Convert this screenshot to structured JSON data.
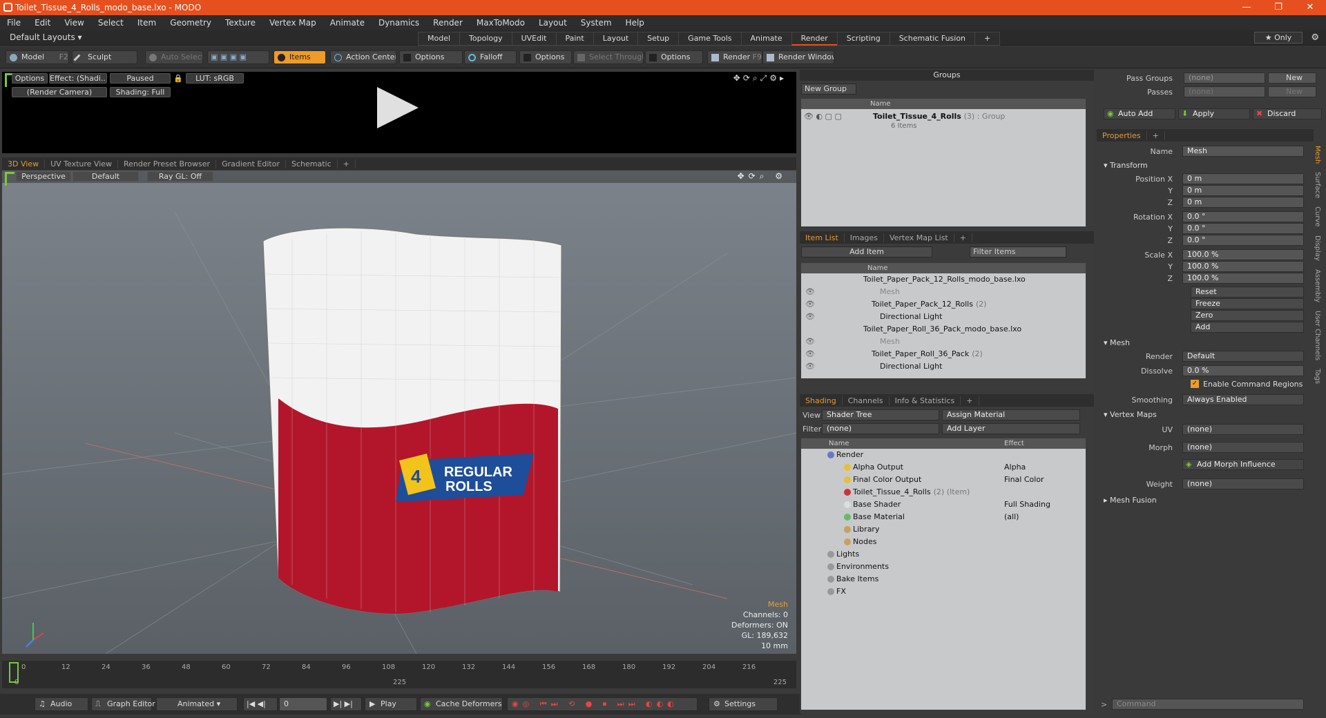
{
  "window": {
    "title": "Toilet_Tissue_4_Rolls_modo_base.lxo - MODO",
    "min": "—",
    "max": "❐",
    "close": "✕"
  },
  "menu": [
    "File",
    "Edit",
    "View",
    "Select",
    "Item",
    "Geometry",
    "Texture",
    "Vertex Map",
    "Animate",
    "Dynamics",
    "Render",
    "MaxToModo",
    "Layout",
    "System",
    "Help"
  ],
  "layouts": {
    "default": "Default Layouts ▾",
    "tabs": [
      "Model",
      "Topology",
      "UVEdit",
      "Paint",
      "Layout",
      "Setup",
      "Game Tools",
      "Animate",
      "Render",
      "Scripting",
      "Schematic Fusion"
    ],
    "active": "Render",
    "plus": "+",
    "only": "★ Only"
  },
  "toolbar": {
    "model": "Model",
    "model_key": "F2",
    "sculpt": "Sculpt",
    "auto_select": "Auto Select",
    "items": "Items",
    "action_center": "Action Center",
    "options1": "Options",
    "falloff": "Falloff",
    "options2": "Options",
    "select_through": "Select Through",
    "options3": "Options",
    "render": "Render",
    "render_key": "F9",
    "render_window": "Render Window"
  },
  "preview": {
    "options": "Options",
    "effect": "Effect: (Shadi...",
    "paused": "Paused",
    "lut": "LUT: sRGB",
    "camera": "(Render Camera)",
    "shading": "Shading: Full"
  },
  "view_tabs": [
    "3D View",
    "UV Texture View",
    "Render Preset Browser",
    "Gradient Editor",
    "Schematic",
    "+"
  ],
  "viewport": {
    "perspective": "Perspective",
    "default": "Default",
    "raygl": "Ray GL: Off",
    "label_4": "4",
    "label_regular": "REGULAR",
    "label_rolls": "ROLLS",
    "hud": {
      "mesh": "Mesh",
      "channels": "Channels: 0",
      "deformers": "Deformers: ON",
      "gl": "GL: 189,632",
      "size": "10 mm"
    }
  },
  "timeline": {
    "ticks": [
      "0",
      "12",
      "24",
      "36",
      "48",
      "60",
      "72",
      "84",
      "96",
      "108",
      "120",
      "132",
      "144",
      "156",
      "168",
      "180",
      "192",
      "204",
      "216"
    ],
    "end1": "225",
    "end2": "225",
    "start": "0"
  },
  "bottom": {
    "audio": "Audio",
    "graph": "Graph Editor",
    "animated": "Animated",
    "frame": "0",
    "play": "Play",
    "cache": "Cache Deformers",
    "settings": "Settings"
  },
  "groups": {
    "header": "Groups",
    "new_group": "New Group",
    "col_name": "Name",
    "item": "Toilet_Tissue_4_Rolls",
    "item_suffix": "(3) : Group",
    "item_count": "6 Items"
  },
  "itemlist": {
    "tabs": [
      "Item List",
      "Images",
      "Vertex Map List",
      "+"
    ],
    "add_item": "Add Item",
    "filter": "Filter Items",
    "col_name": "Name",
    "rows": [
      {
        "t": "Toilet_Paper_Pack_12_Rolls_modo_base.lxo",
        "d": 0
      },
      {
        "t": "Mesh",
        "d": 2,
        "dim": true
      },
      {
        "t": "Toilet_Paper_Pack_12_Rolls",
        "s": "(2)",
        "d": 1
      },
      {
        "t": "Directional Light",
        "d": 2
      },
      {
        "t": "Toilet_Paper_Roll_36_Pack_modo_base.lxo",
        "d": 0
      },
      {
        "t": "Mesh",
        "d": 2,
        "dim": true
      },
      {
        "t": "Toilet_Paper_Roll_36_Pack",
        "s": "(2)",
        "d": 1
      },
      {
        "t": "Directional Light",
        "d": 2
      }
    ]
  },
  "shading": {
    "tabs": [
      "Shading",
      "Channels",
      "Info & Statistics",
      "+"
    ],
    "view_label": "View",
    "view": "Shader Tree",
    "assign": "Assign Material",
    "filter_label": "Filter",
    "filter": "(none)",
    "add_layer": "Add Layer",
    "col_name": "Name",
    "col_effect": "Effect",
    "rows": [
      {
        "n": "Render",
        "e": "",
        "d": 0
      },
      {
        "n": "Alpha Output",
        "e": "Alpha",
        "d": 1
      },
      {
        "n": "Final Color Output",
        "e": "Final Color",
        "d": 1
      },
      {
        "n": "Toilet_Tissue_4_Rolls",
        "s": "(2) (Item)",
        "e": "",
        "d": 1
      },
      {
        "n": "Base Shader",
        "e": "Full Shading",
        "d": 1
      },
      {
        "n": "Base Material",
        "e": "(all)",
        "d": 1
      },
      {
        "n": "Library",
        "e": "",
        "d": 1
      },
      {
        "n": "Nodes",
        "e": "",
        "d": 1
      },
      {
        "n": "Lights",
        "e": "",
        "d": 0
      },
      {
        "n": "Environments",
        "e": "",
        "d": 0
      },
      {
        "n": "Bake Items",
        "e": "",
        "d": 0
      },
      {
        "n": "FX",
        "e": "",
        "d": 0
      }
    ]
  },
  "props": {
    "pass_groups": "Pass Groups",
    "passes": "Passes",
    "none": "(none)",
    "new": "New",
    "auto_add": "Auto Add",
    "apply": "Apply",
    "discard": "Discard",
    "tab": "Properties",
    "plus": "+",
    "name_label": "Name",
    "name": "Mesh",
    "transform": "Transform",
    "position_x": "Position X",
    "y": "Y",
    "z": "Z",
    "pos": [
      "0 m",
      "0 m",
      "0 m"
    ],
    "rotation_x": "Rotation X",
    "rot": [
      "0.0 °",
      "0.0 °",
      "0.0 °"
    ],
    "scale_x": "Scale X",
    "scale": [
      "100.0 %",
      "100.0 %",
      "100.0 %"
    ],
    "reset": "Reset",
    "freeze": "Freeze",
    "zero": "Zero",
    "add": "Add",
    "mesh": "Mesh",
    "render_label": "Render",
    "render": "Default",
    "dissolve_label": "Dissolve",
    "dissolve": "0.0 %",
    "enable_cmd": "Enable Command Regions",
    "smoothing_label": "Smoothing",
    "smoothing": "Always Enabled",
    "vertex_maps": "Vertex Maps",
    "uv_label": "UV",
    "uv": "(none)",
    "morph_label": "Morph",
    "morph": "(none)",
    "add_morph": "Add Morph Influence",
    "weight_label": "Weight",
    "weight": "(none)",
    "mesh_fusion": "Mesh Fusion",
    "command": "Command",
    "vtabs": [
      "Mesh",
      "Surface",
      "Curve",
      "Display",
      "Assembly",
      "User Channels",
      "Tags"
    ]
  },
  "colors": {
    "accent": "#e6501e",
    "orange": "#e89a30"
  }
}
